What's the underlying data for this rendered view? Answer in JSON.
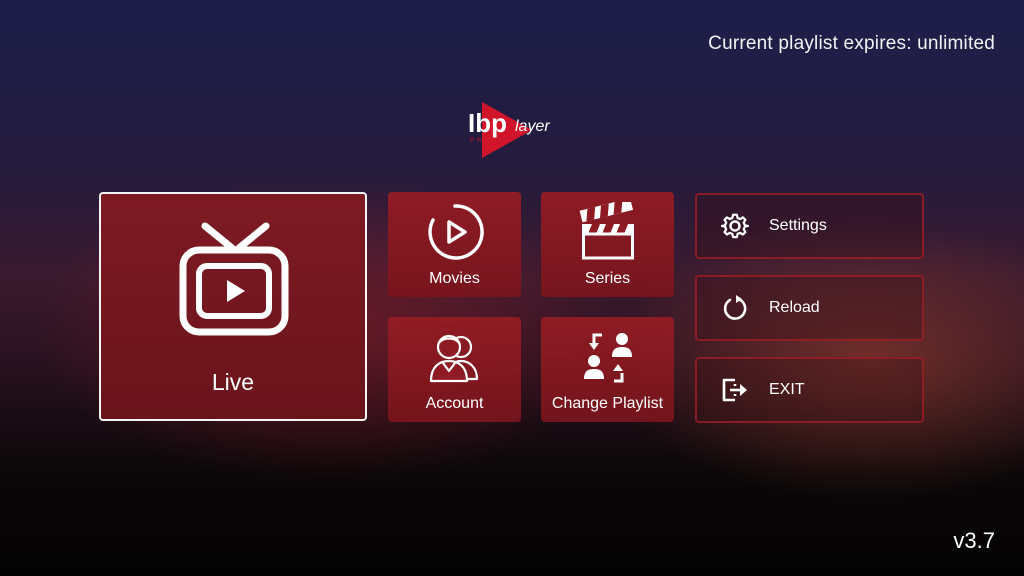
{
  "header": {
    "expires_text": "Current playlist expires: unlimited"
  },
  "logo": {
    "wordmark_a": "Ibp",
    "wordmark_b": "layer",
    "sub": "PRO",
    "icon": "play-triangle-logo"
  },
  "tiles": {
    "live": {
      "label": "Live",
      "icon": "tv-icon"
    },
    "movies": {
      "label": "Movies",
      "icon": "play-circle-icon"
    },
    "series": {
      "label": "Series",
      "icon": "clapperboard-icon"
    },
    "account": {
      "label": "Account",
      "icon": "users-icon"
    },
    "change_playlist": {
      "label": "Change Playlist",
      "icon": "swap-users-icon"
    }
  },
  "side_menu": {
    "settings": {
      "label": "Settings",
      "icon": "gear-icon"
    },
    "reload": {
      "label": "Reload",
      "icon": "reload-icon"
    },
    "exit": {
      "label": "EXIT",
      "icon": "exit-icon"
    }
  },
  "footer": {
    "version": "v3.7"
  },
  "colors": {
    "tile_red": "#8e1a24",
    "live_selected_border": "#f4f4f4",
    "side_border": "#961e26",
    "logo_red": "#d0142a"
  }
}
